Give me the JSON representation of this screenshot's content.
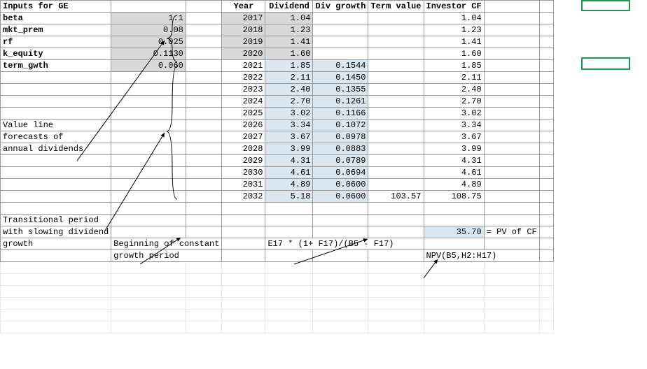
{
  "header": {
    "title": "Inputs for GE",
    "col_year": "Year",
    "col_div": "Dividend",
    "col_divg": "Div growth",
    "col_term": "Term value",
    "col_inv": "Investor CF"
  },
  "inputs": {
    "beta_label": "beta",
    "beta": "1.1",
    "mkt_prem_label": "mkt_prem",
    "mkt_prem": "0.08",
    "rf_label": "rf",
    "rf": "0.025",
    "k_equity_label": "k_equity",
    "k_equity": "0.1130",
    "term_gwth_label": "term_gwth",
    "term_gwth": "0.060"
  },
  "rows": [
    {
      "year": "2017",
      "div": "1.04",
      "divg": "",
      "term": "",
      "inv": "1.04"
    },
    {
      "year": "2018",
      "div": "1.23",
      "divg": "",
      "term": "",
      "inv": "1.23"
    },
    {
      "year": "2019",
      "div": "1.41",
      "divg": "",
      "term": "",
      "inv": "1.41"
    },
    {
      "year": "2020",
      "div": "1.60",
      "divg": "",
      "term": "",
      "inv": "1.60"
    },
    {
      "year": "2021",
      "div": "1.85",
      "divg": "0.1544",
      "term": "",
      "inv": "1.85"
    },
    {
      "year": "2022",
      "div": "2.11",
      "divg": "0.1450",
      "term": "",
      "inv": "2.11"
    },
    {
      "year": "2023",
      "div": "2.40",
      "divg": "0.1355",
      "term": "",
      "inv": "2.40"
    },
    {
      "year": "2024",
      "div": "2.70",
      "divg": "0.1261",
      "term": "",
      "inv": "2.70"
    },
    {
      "year": "2025",
      "div": "3.02",
      "divg": "0.1166",
      "term": "",
      "inv": "3.02"
    },
    {
      "year": "2026",
      "div": "3.34",
      "divg": "0.1072",
      "term": "",
      "inv": "3.34"
    },
    {
      "year": "2027",
      "div": "3.67",
      "divg": "0.0978",
      "term": "",
      "inv": "3.67"
    },
    {
      "year": "2028",
      "div": "3.99",
      "divg": "0.0883",
      "term": "",
      "inv": "3.99"
    },
    {
      "year": "2029",
      "div": "4.31",
      "divg": "0.0789",
      "term": "",
      "inv": "4.31"
    },
    {
      "year": "2030",
      "div": "4.61",
      "divg": "0.0694",
      "term": "",
      "inv": "4.61"
    },
    {
      "year": "2031",
      "div": "4.89",
      "divg": "0.0600",
      "term": "",
      "inv": "4.89"
    },
    {
      "year": "2032",
      "div": "5.18",
      "divg": "0.0600",
      "term": "103.57",
      "inv": "108.75"
    }
  ],
  "notes": {
    "value_line_1": "Value line",
    "value_line_2": "forecasts of",
    "value_line_3": "annual dividends",
    "trans_1": "Transitional period",
    "trans_2": "with slowing dividend",
    "trans_3": "growth",
    "begin_1": "Beginning of constant",
    "begin_2": "growth period",
    "term_formula": "E17 * (1+ F17)/(B5 - F17)",
    "pv_value": "35.70",
    "pv_label": "= PV of CF",
    "npv_formula": "NPV(B5,H2:H17)"
  }
}
